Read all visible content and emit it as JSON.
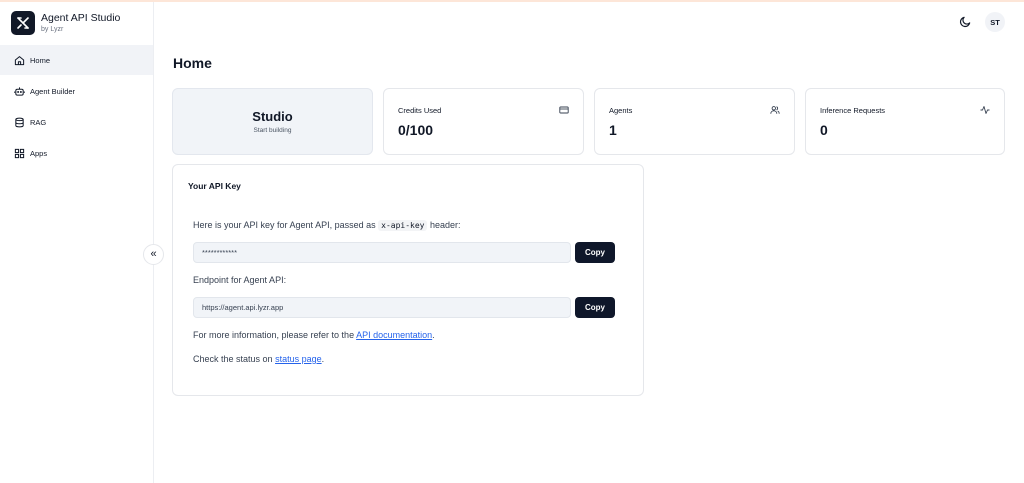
{
  "brand": {
    "title": "Agent API Studio",
    "subtitle": "by Lyzr",
    "icon": "lyzr-logo-icon"
  },
  "sidebar": {
    "items": [
      {
        "label": "Home",
        "icon": "home-icon",
        "active": true
      },
      {
        "label": "Agent Builder",
        "icon": "bot-icon",
        "active": false
      },
      {
        "label": "RAG",
        "icon": "database-icon",
        "active": false
      },
      {
        "label": "Apps",
        "icon": "apps-grid-icon",
        "active": false
      }
    ],
    "collapse_glyph": "«"
  },
  "header": {
    "avatar_initials": "ST",
    "theme_icon": "moon-icon"
  },
  "main": {
    "title": "Home",
    "studio_card": {
      "title": "Studio",
      "subtitle": "Start building"
    },
    "stats": [
      {
        "label": "Credits Used",
        "value": "0/100",
        "icon": "credit-card-icon"
      },
      {
        "label": "Agents",
        "value": "1",
        "icon": "users-icon"
      },
      {
        "label": "Inference Requests",
        "value": "0",
        "icon": "activity-icon"
      }
    ],
    "api": {
      "title": "Your API Key",
      "intro_before": "Here is your API key for Agent API, passed as",
      "intro_code": "x-api-key",
      "intro_after": "header:",
      "key_value": "************",
      "copy_label": "Copy",
      "endpoint_label": "Endpoint for Agent API:",
      "endpoint_value": "https://agent.api.lyzr.app",
      "info_before": "For more information, please refer to the",
      "info_link": "API documentation",
      "info_after": ".",
      "status_before": "Check the status on",
      "status_link": "status page",
      "status_after": "."
    }
  },
  "colors": {
    "accent_dark": "#0f172a",
    "link": "#2563eb",
    "active_bg": "#f1f3f7"
  }
}
